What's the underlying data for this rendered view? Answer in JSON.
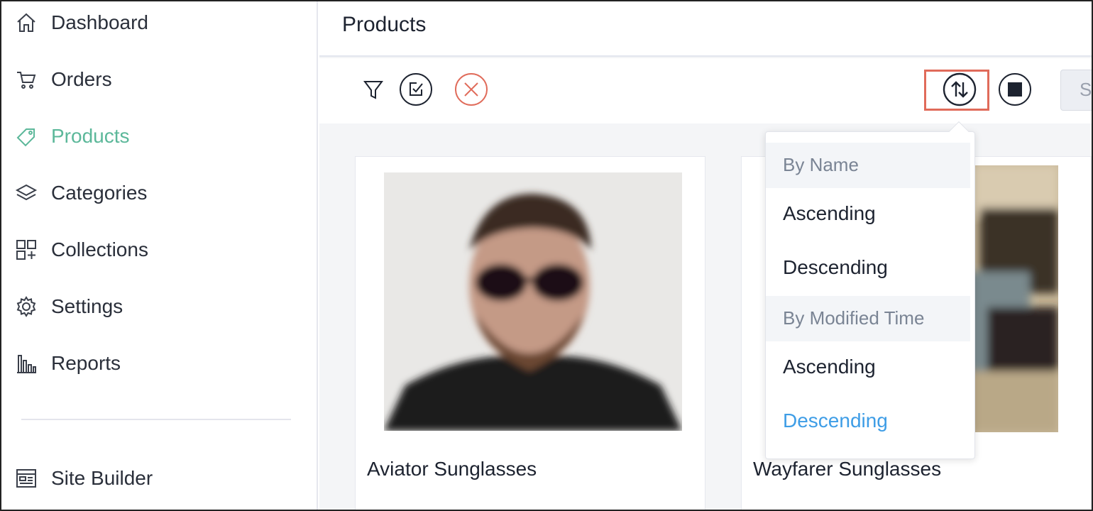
{
  "sidebar": {
    "items": [
      {
        "label": "Dashboard",
        "icon": "home-icon"
      },
      {
        "label": "Orders",
        "icon": "cart-icon"
      },
      {
        "label": "Products",
        "icon": "tag-icon",
        "active": true
      },
      {
        "label": "Categories",
        "icon": "layers-icon"
      },
      {
        "label": "Collections",
        "icon": "collections-grid-icon"
      },
      {
        "label": "Settings",
        "icon": "gear-icon"
      },
      {
        "label": "Reports",
        "icon": "bar-chart-icon"
      }
    ],
    "footer_item": {
      "label": "Site Builder",
      "icon": "site-builder-icon"
    }
  },
  "header": {
    "title": "Products"
  },
  "toolbar": {
    "filter_icon": "filter-icon",
    "select_icon": "select-checkbox-icon",
    "clear_icon": "close-circle-icon",
    "sort_icon": "sort-arrows-icon",
    "view_icon": "grid-view-icon",
    "search_stub": "S"
  },
  "sort_menu": {
    "groups": [
      {
        "label": "By Name",
        "options": [
          "Ascending",
          "Descending"
        ]
      },
      {
        "label": "By Modified Time",
        "options": [
          "Ascending",
          "Descending"
        ]
      }
    ],
    "selected": {
      "group": "By Modified Time",
      "option": "Descending"
    }
  },
  "products": [
    {
      "name": "Aviator Sunglasses"
    },
    {
      "name": "Wayfarer Sunglasses"
    }
  ],
  "colors": {
    "active_nav": "#5cb89a",
    "selected_option": "#3e9de6",
    "highlight_box": "#e06b5a",
    "clear_icon": "#e06b5a"
  }
}
